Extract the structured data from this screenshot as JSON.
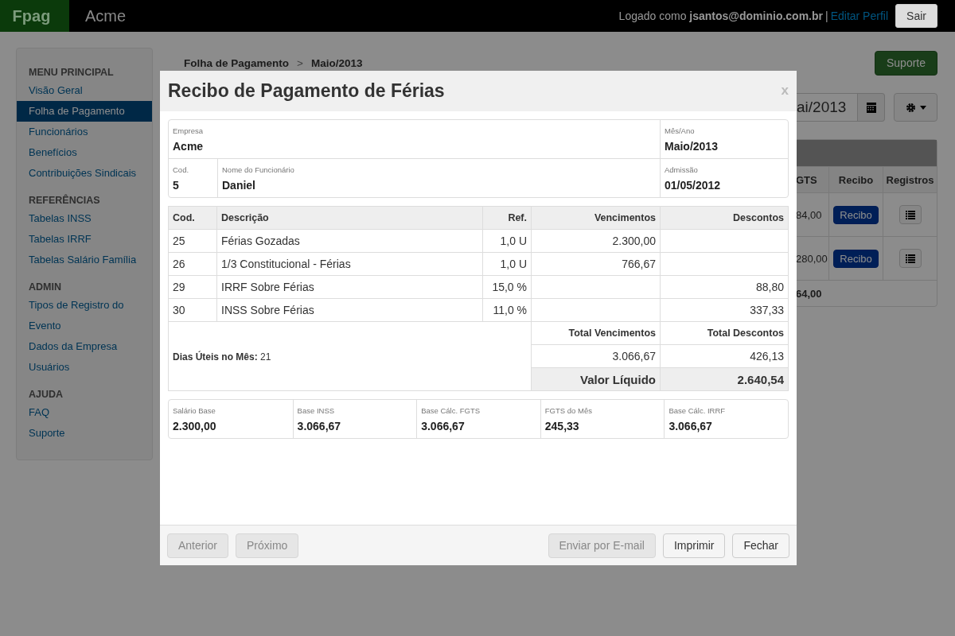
{
  "navbar": {
    "brand": "Fpag",
    "company": "Acme",
    "login_text": "Logado como **jsantos@dominio.com.br**",
    "separator": "|",
    "edit_profile": "Editar Perfil",
    "logout": "Sair"
  },
  "sidebar": {
    "sections": [
      {
        "heading": "MENU PRINCIPAL",
        "items": [
          {
            "label": "Visão Geral",
            "selected": false
          },
          {
            "label": "Folha de Pagamento",
            "selected": true
          },
          {
            "label": "Funcionários",
            "selected": false
          },
          {
            "label": "Benefícios",
            "selected": false
          },
          {
            "label": "Contribuições Sindicais",
            "selected": false
          }
        ]
      },
      {
        "heading": "REFERÊNCIAS",
        "items": [
          {
            "label": "Tabelas INSS",
            "selected": false
          },
          {
            "label": "Tabelas IRRF",
            "selected": false
          },
          {
            "label": "Tabelas Salário Família",
            "selected": false
          }
        ]
      },
      {
        "heading": "ADMIN",
        "items": [
          {
            "label": "Tipos de Registro do Evento",
            "selected": false
          },
          {
            "label": "Dados da Empresa",
            "selected": false
          },
          {
            "label": "Usuários",
            "selected": false
          }
        ]
      },
      {
        "heading": "AJUDA",
        "items": [
          {
            "label": "FAQ",
            "selected": false
          },
          {
            "label": "Suporte",
            "selected": false
          }
        ]
      }
    ]
  },
  "breadcrumb": {
    "items": [
      "Folha de Pagamento",
      "Maio/2013"
    ],
    "separator": ">"
  },
  "support_button": "Suporte",
  "period_field": {
    "value": "ai/2013"
  },
  "payroll_table": {
    "columns": [
      "GTS",
      "Recibo",
      "Registros"
    ],
    "rows": [
      {
        "column_1": "84,00",
        "receipt_button": "Recibo"
      },
      {
        "column_1": "280,00",
        "receipt_button": "Recibo"
      }
    ],
    "total": "64,00"
  },
  "modal": {
    "title": "Recibo de Pagamento de Férias",
    "close": "x",
    "info_rows": [
      [
        {
          "label": "Empresa",
          "value": "Acme"
        },
        {
          "label": "Mês/Ano",
          "value": "Maio/2013"
        }
      ],
      [
        {
          "label": "Cod.",
          "value": "5"
        },
        {
          "label": "Nome do Funcionário",
          "value": "Daniel"
        },
        {
          "label": "Admissão",
          "value": "01/05/2012"
        }
      ]
    ],
    "items": {
      "columns": [
        "Cod.",
        "Descrição",
        "Ref.",
        "Vencimentos",
        "Descontos"
      ],
      "rows": [
        [
          "25",
          "Férias Gozadas",
          "1,0 U",
          "2.300,00",
          ""
        ],
        [
          "26",
          "1/3 Constitucional - Férias",
          "1,0 U",
          "766,67",
          ""
        ],
        [
          "29",
          "IRRF Sobre Férias",
          "15,0 %",
          "",
          "88,80"
        ],
        [
          "30",
          "INSS Sobre Férias",
          "11,0 %",
          "",
          "337,33"
        ]
      ]
    },
    "working_days": {
      "label": "Dias Úteis no Mês:",
      "value": "21"
    },
    "totals": {
      "earnings_label": "Total Vencimentos",
      "deductions_label": "Total Descontos",
      "earnings": "3.066,67",
      "deductions": "426,13",
      "net_label": "Valor Líquido",
      "net": "2.640,54"
    },
    "bases": [
      {
        "label": "Salário Base",
        "value": "2.300,00"
      },
      {
        "label": "Base INSS",
        "value": "3.066,67"
      },
      {
        "label": "Base Cálc. FGTS",
        "value": "3.066,67"
      },
      {
        "label": "FGTS do Mês",
        "value": "245,33"
      },
      {
        "label": "Base Cálc. IRRF",
        "value": "3.066,67"
      }
    ],
    "footer": {
      "left_buttons": [
        {
          "label": "Anterior",
          "disabled": true
        },
        {
          "label": "Próximo",
          "disabled": true
        }
      ],
      "right_buttons": [
        {
          "label": "Enviar por E-mail",
          "disabled": true
        },
        {
          "label": "Imprimir",
          "disabled": false
        },
        {
          "label": "Fechar",
          "disabled": false
        }
      ]
    }
  }
}
